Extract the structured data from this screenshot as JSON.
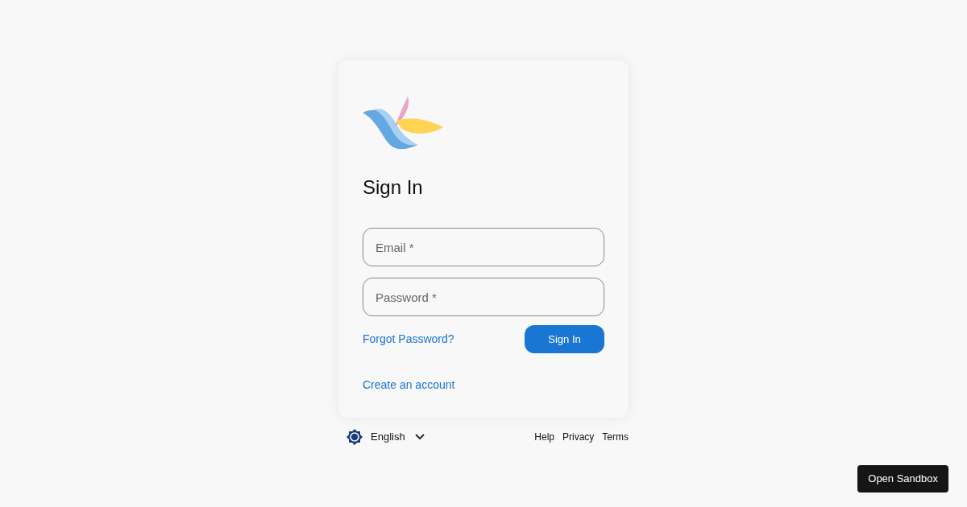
{
  "title": "Sign In",
  "fields": [
    {
      "placeholder": "Email *"
    },
    {
      "placeholder": "Password *"
    }
  ],
  "forgot_link": "Forgot Password?",
  "submit_button": "Sign In",
  "create_link": "Create an account",
  "language": "English",
  "footer_links": [
    "Help",
    "Privacy",
    "Terms"
  ],
  "sandbox_button": "Open Sandbox"
}
